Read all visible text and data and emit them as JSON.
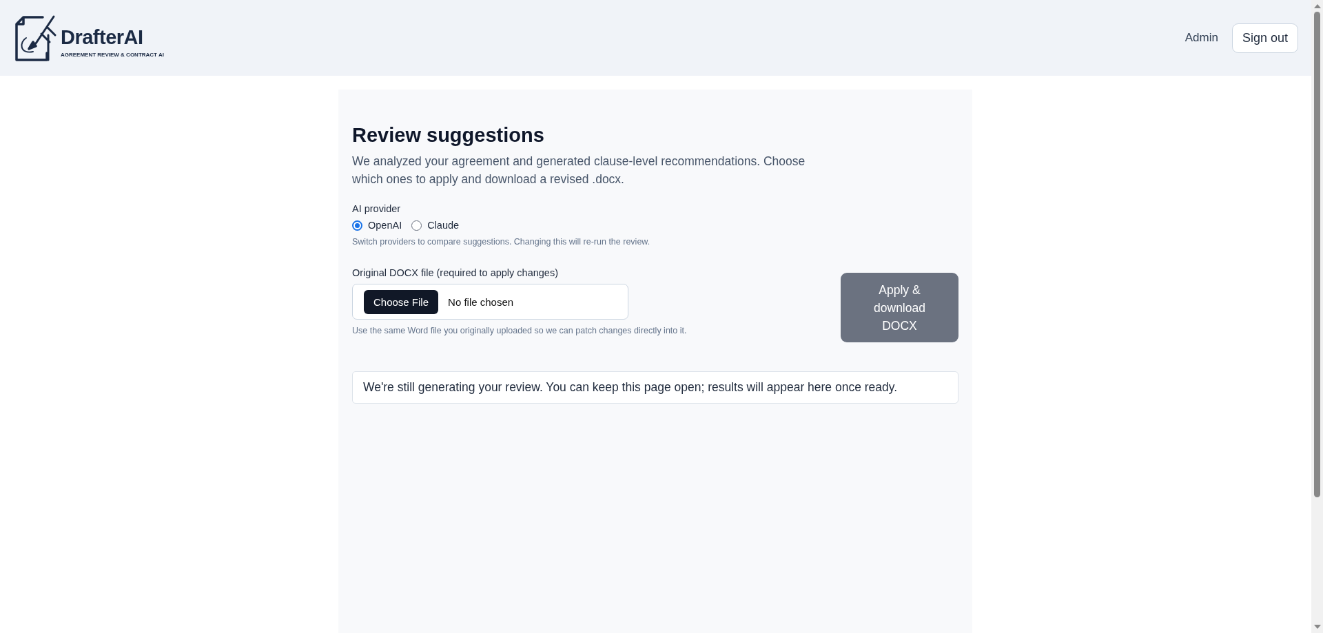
{
  "header": {
    "brand": {
      "name": "DrafterAI",
      "tagline": "AGREEMENT REVIEW & CONTRACT AI"
    },
    "user": "Admin",
    "sign_out": "Sign out"
  },
  "review": {
    "title": "Review suggestions",
    "description": "We analyzed your agreement and generated clause-level recommendations. Choose which ones to apply and download a revised .docx.",
    "provider": {
      "label": "AI provider",
      "options": [
        {
          "label": "OpenAI",
          "selected": true
        },
        {
          "label": "Claude",
          "selected": false
        }
      ],
      "hint": "Switch providers to compare suggestions. Changing this will re-run the review."
    },
    "file": {
      "label": "Original DOCX file (required to apply changes)",
      "button": "Choose File",
      "status": "No file chosen",
      "hint": "Use the same Word file you originally uploaded so we can patch changes directly into it."
    },
    "apply_button": {
      "label": "Apply & download DOCX",
      "disabled": true
    },
    "status_message": "We're still generating your review. You can keep this page open; results will appear here once ready."
  }
}
